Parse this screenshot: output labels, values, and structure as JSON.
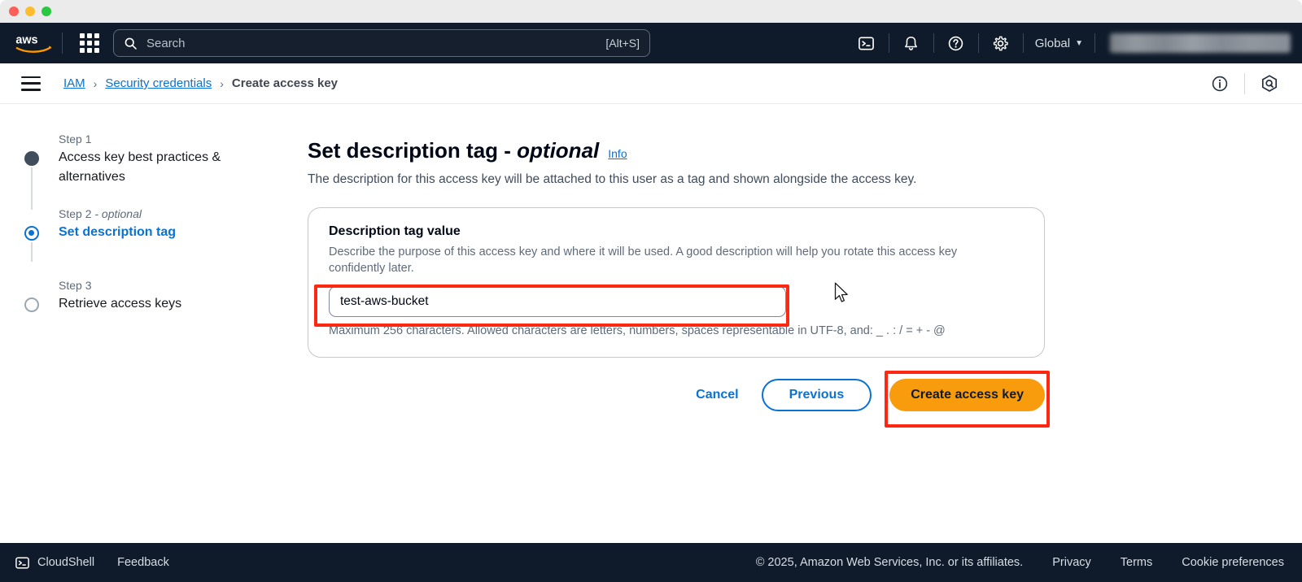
{
  "window": {
    "controls": [
      "close",
      "minimize",
      "zoom"
    ]
  },
  "topnav": {
    "logo": "aws-logo",
    "apps_icon": "apps-grid-icon",
    "search": {
      "icon": "search-icon",
      "placeholder": "Search",
      "shortcut": "[Alt+S]"
    },
    "icons": [
      {
        "name": "cloudshell-icon"
      },
      {
        "name": "notifications-bell-icon"
      },
      {
        "name": "help-question-icon"
      },
      {
        "name": "settings-gear-icon"
      }
    ],
    "region": {
      "label": "Global",
      "caret": "▼"
    },
    "account": "account-menu-blurred"
  },
  "breadcrumb": {
    "menu_icon": "hamburger-menu-icon",
    "items": [
      {
        "label": "IAM",
        "link": true
      },
      {
        "label": "Security credentials",
        "link": true
      },
      {
        "label": "Create access key",
        "link": false
      }
    ],
    "separator": "›",
    "right_icons": [
      {
        "name": "info-circle-icon"
      },
      {
        "name": "amazon-q-icon"
      }
    ]
  },
  "wizard": {
    "steps": [
      {
        "step_label": "Step 1",
        "optional_suffix": "",
        "name": "Access key best practices & alternatives",
        "state": "done"
      },
      {
        "step_label": "Step 2",
        "optional_suffix": " - optional",
        "name": "Set description tag",
        "state": "active"
      },
      {
        "step_label": "Step 3",
        "optional_suffix": "",
        "name": "Retrieve access keys",
        "state": "todo"
      }
    ]
  },
  "main": {
    "title_main": "Set description tag - ",
    "title_italic": "optional",
    "info_link": "Info",
    "subtitle": "The description for this access key will be attached to this user as a tag and shown alongside the access key.",
    "card": {
      "heading": "Description tag value",
      "description": "Describe the purpose of this access key and where it will be used. A good description will help you rotate this access key confidently later.",
      "input_value": "test-aws-bucket",
      "input_placeholder": "",
      "hint": "Maximum 256 characters. Allowed characters are letters, numbers, spaces representable in UTF-8, and: _ . : / = + - @"
    },
    "actions": {
      "cancel": "Cancel",
      "previous": "Previous",
      "create": "Create access key"
    }
  },
  "footer": {
    "cloudshell": "CloudShell",
    "cloudshell_icon": "cloudshell-icon",
    "feedback": "Feedback",
    "copyright": "© 2025, Amazon Web Services, Inc. or its affiliates.",
    "links": [
      "Privacy",
      "Terms",
      "Cookie preferences"
    ]
  },
  "annotations": {
    "accent_red": "#fe2712",
    "highlight_input": "description-tag-input",
    "highlight_button": "create-access-key-button"
  },
  "colors": {
    "nav_background": "#0f1b2a",
    "link_blue": "#0972d3",
    "primary_orange": "#f89b0c",
    "text_dark": "#000716",
    "text_muted": "#5f6b7a"
  }
}
